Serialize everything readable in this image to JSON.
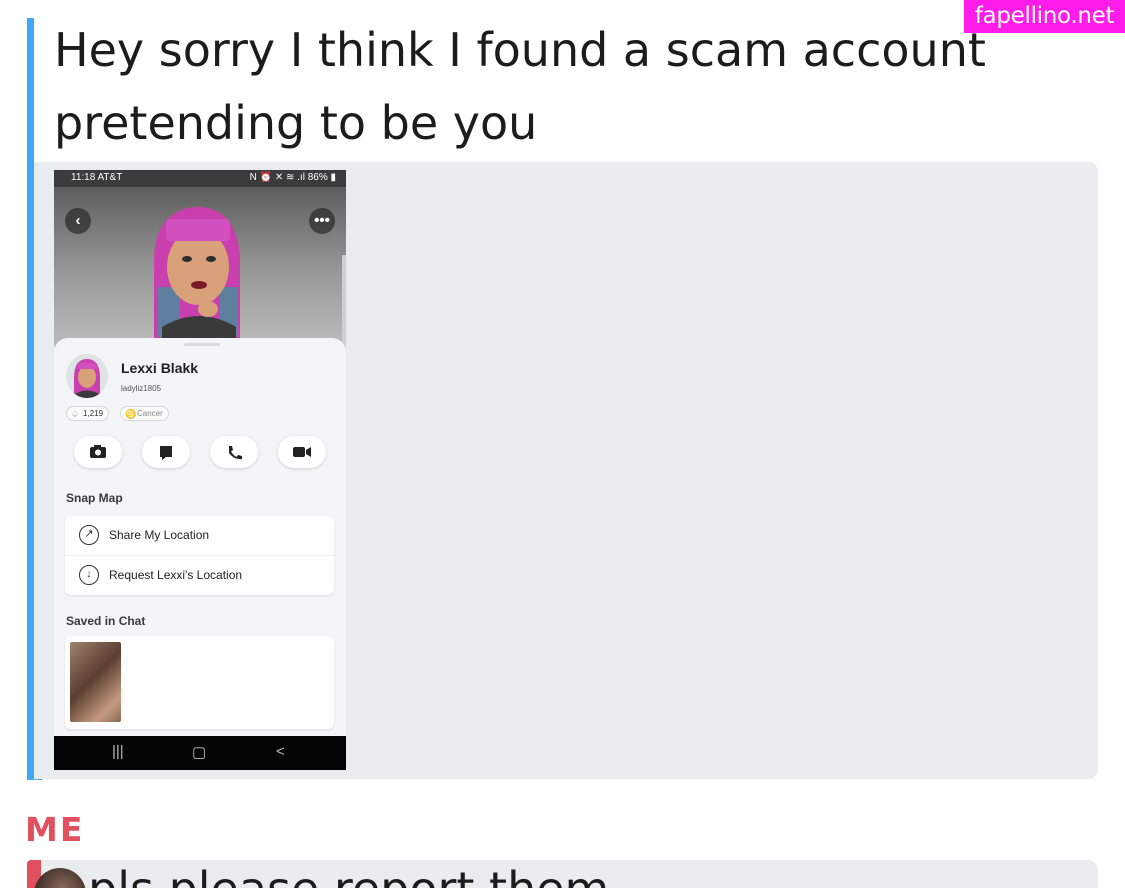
{
  "watermark": "fapellino.net",
  "message1": {
    "text": "Hey sorry I think I found a scam account pretending to be you"
  },
  "screenshot": {
    "status_time": "11:18 AT&T",
    "status_right": "N ⏰ ✕ ≋ .ıl 86% ▮",
    "back_icon": "chevron-left-icon",
    "more_icon": "more-dots-icon",
    "profile_name": "Lexxi Blakk",
    "username": "ladyliz1805",
    "score": "1,219",
    "zodiac": "Cancer",
    "actions": [
      "camera-icon",
      "chat-icon",
      "phone-icon",
      "video-icon"
    ],
    "snap_map_title": "Snap Map",
    "map_items": [
      "Share My Location",
      "Request Lexxi's Location"
    ],
    "saved_title": "Saved in Chat",
    "navbar": [
      "|||",
      "▢",
      "<"
    ]
  },
  "sender": "ME",
  "message2": {
    "text": "pls please report them"
  },
  "colors": {
    "accent_blue": "#3fa9f5",
    "accent_red": "#e0505e",
    "panel": "#eaedef",
    "watermark_bg": "#ff1ce8"
  }
}
